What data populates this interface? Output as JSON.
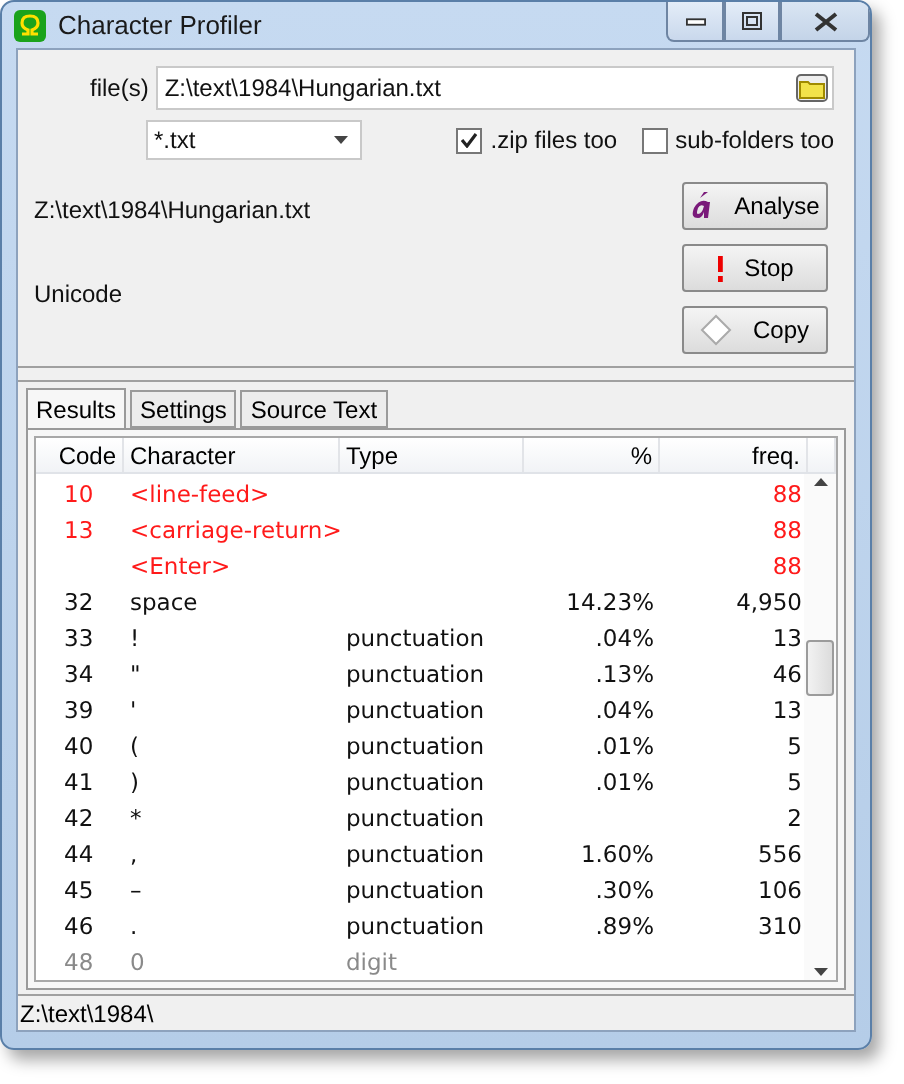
{
  "window": {
    "title": "Character Profiler"
  },
  "files_label": "file(s)",
  "files_value": "Z:\\text\\1984\\Hungarian.txt",
  "filter": {
    "value": "*.txt"
  },
  "options": [
    {
      "label": ".zip files too",
      "checked": true
    },
    {
      "label": "sub-folders too",
      "checked": false
    }
  ],
  "current_file": "Z:\\text\\1984\\Hungarian.txt",
  "encoding": "Unicode",
  "buttons": [
    {
      "kind": "analyse",
      "label": "Analyse"
    },
    {
      "kind": "stop",
      "label": "Stop"
    },
    {
      "kind": "copy",
      "label": "Copy"
    }
  ],
  "tabs": [
    {
      "label": "Results",
      "selected": true
    },
    {
      "label": "Settings",
      "selected": false
    },
    {
      "label": "Source Text",
      "selected": false
    }
  ],
  "table": {
    "columns": [
      "Code",
      "Character",
      "Type",
      "%",
      "freq."
    ],
    "rows": [
      {
        "kind": "control",
        "cells": [
          "10",
          "<line-feed>",
          "",
          "",
          "88"
        ]
      },
      {
        "kind": "control",
        "cells": [
          "13",
          "<carriage-return>",
          "",
          "",
          "88"
        ]
      },
      {
        "kind": "control",
        "cells": [
          "",
          "<Enter>",
          "",
          "",
          "88"
        ]
      },
      {
        "kind": "normal",
        "cells": [
          "32",
          "space",
          "",
          "14.23%",
          "4,950"
        ]
      },
      {
        "kind": "normal",
        "cells": [
          "33",
          "!",
          "punctuation",
          ".04%",
          "13"
        ]
      },
      {
        "kind": "normal",
        "cells": [
          "34",
          "\"",
          "punctuation",
          ".13%",
          "46"
        ]
      },
      {
        "kind": "normal",
        "cells": [
          "39",
          "'",
          "punctuation",
          ".04%",
          "13"
        ]
      },
      {
        "kind": "normal",
        "cells": [
          "40",
          "(",
          "punctuation",
          ".01%",
          "5"
        ]
      },
      {
        "kind": "normal",
        "cells": [
          "41",
          ")",
          "punctuation",
          ".01%",
          "5"
        ]
      },
      {
        "kind": "normal",
        "cells": [
          "42",
          "*",
          "punctuation",
          "",
          "2"
        ]
      },
      {
        "kind": "normal",
        "cells": [
          "44",
          ",",
          "punctuation",
          "1.60%",
          "556"
        ]
      },
      {
        "kind": "normal",
        "cells": [
          "45",
          "–",
          "punctuation",
          ".30%",
          "106"
        ]
      },
      {
        "kind": "normal",
        "cells": [
          "46",
          ".",
          "punctuation",
          ".89%",
          "310"
        ]
      },
      {
        "kind": "faded",
        "cells": [
          "48",
          "0",
          "digit",
          "",
          ""
        ]
      }
    ]
  },
  "status_bar": "Z:\\text\\1984\\"
}
